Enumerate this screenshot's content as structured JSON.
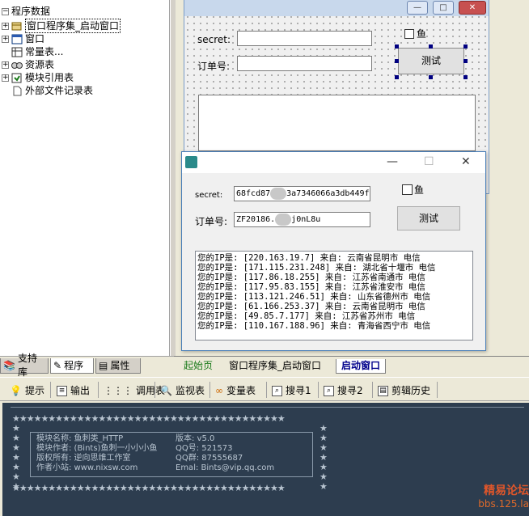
{
  "tree": {
    "root": "程序数据",
    "items": [
      {
        "label": "窗口程序集_启动窗口",
        "expand": "+"
      },
      {
        "label": "窗口",
        "expand": "+"
      },
      {
        "label": "常量表...",
        "expand": ""
      },
      {
        "label": "资源表",
        "expand": "+"
      },
      {
        "label": "模块引用表",
        "expand": "+"
      },
      {
        "label": "外部文件记录表",
        "expand": ""
      }
    ]
  },
  "left_tabs": [
    "支持库",
    "程序",
    "属性"
  ],
  "designer": {
    "secret_label": "secret:",
    "order_label": "订单号:",
    "fish_label": "鱼",
    "test_button": "测试",
    "min": "—",
    "max": "□",
    "close": "✕"
  },
  "popup": {
    "title_min": "—",
    "title_max": "☐",
    "title_close": "✕",
    "secret_label": "secret:",
    "secret_prefix": "68fcd87",
    "secret_suffix": "3a7346066a3db449f",
    "order_label": "订单号:",
    "order_prefix": "ZF20186.",
    "order_suffix": "j0nL8u",
    "fish_label": "鱼",
    "test_button": "测试",
    "log": [
      "您的IP是: [220.163.19.7] 来自: 云南省昆明市 电信",
      "您的IP是: [171.115.231.248] 来自: 湖北省十堰市 电信",
      "您的IP是: [117.86.18.255] 来自: 江苏省南通市 电信",
      "您的IP是: [117.95.83.155] 来自: 江苏省淮安市 电信",
      "您的IP是: [113.121.246.51] 来自: 山东省德州市 电信",
      "您的IP是: [61.166.253.37] 来自: 云南省昆明市 电信",
      "您的IP是: [49.85.7.177] 来自: 江苏省苏州市 电信",
      "您的IP是: [110.167.188.96] 来自: 青海省西宁市 电信"
    ]
  },
  "editor_tabs": [
    "起始页",
    "窗口程序集_启动窗口",
    "启动窗口"
  ],
  "output_tools": [
    "提示",
    "输出",
    "调用表",
    "监视表",
    "变量表",
    "搜寻1",
    "搜寻2",
    "剪辑历史"
  ],
  "console": {
    "rows": [
      [
        "模块名称: 鱼刺类_HTTP",
        "版本: v5.0"
      ],
      [
        "模块作者: (Bints)鱼刺一小小小鱼",
        "QQ号: 521573"
      ],
      [
        "版权所有: 逆向思维工作室",
        "QQ群: 87555687"
      ],
      [
        "作者小站: www.nixsw.com",
        "Emal: Bints@vip.qq.com"
      ]
    ]
  },
  "watermark": {
    "line1": "精易论坛",
    "line2": "bbs.125.la"
  }
}
